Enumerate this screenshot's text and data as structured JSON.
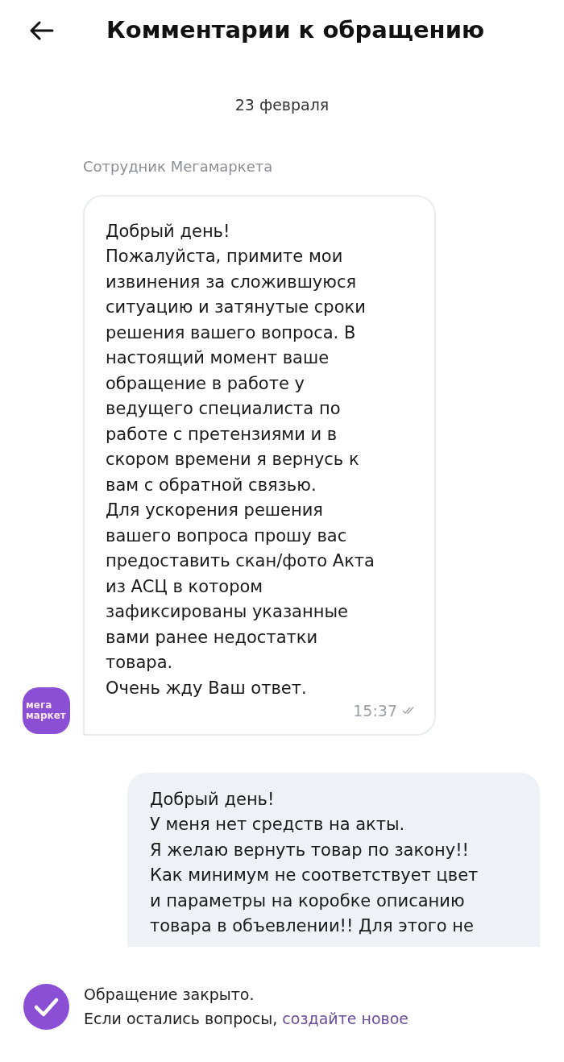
{
  "header": {
    "title": "Комментарии к обращению"
  },
  "date": "23 февраля",
  "messages": [
    {
      "kind": "incoming",
      "sender": "Сотрудник Мегамаркета",
      "avatar": [
        "мега",
        "маркет"
      ],
      "time": "15:37",
      "read": true,
      "lines": [
        "Добрый день!",
        "Пожалуйста, примите мои",
        "извинения за сложившуюся",
        "ситуацию и затянутые сроки",
        "решения вашего вопроса. В",
        "настоящий момент ваше",
        "обращение в работе у",
        "ведущего специалиста по",
        "работе с претензиями и в",
        "скором времени я вернусь к",
        "вам с обратной связью.",
        "Для ускорения решения",
        "вашего вопроса прошу вас",
        "предоставить скан/фото Акта",
        "из АСЦ в котором",
        "зафиксированы указанные",
        "вами ранее недостатки",
        "товара.",
        "Очень жду Ваш ответ."
      ]
    },
    {
      "kind": "outgoing",
      "lines": [
        "Добрый день!",
        "У меня нет средств на акты.",
        "Я желаю вернуть товар по закону!!",
        "Как минимум не соответствует цвет",
        "и параметры на коробке описанию",
        "товара в объевлении!! Для этого не"
      ]
    }
  ],
  "status": {
    "line1": "Обращение закрыто.",
    "line2": "Если остались вопросы,",
    "link": "создайте новое"
  }
}
